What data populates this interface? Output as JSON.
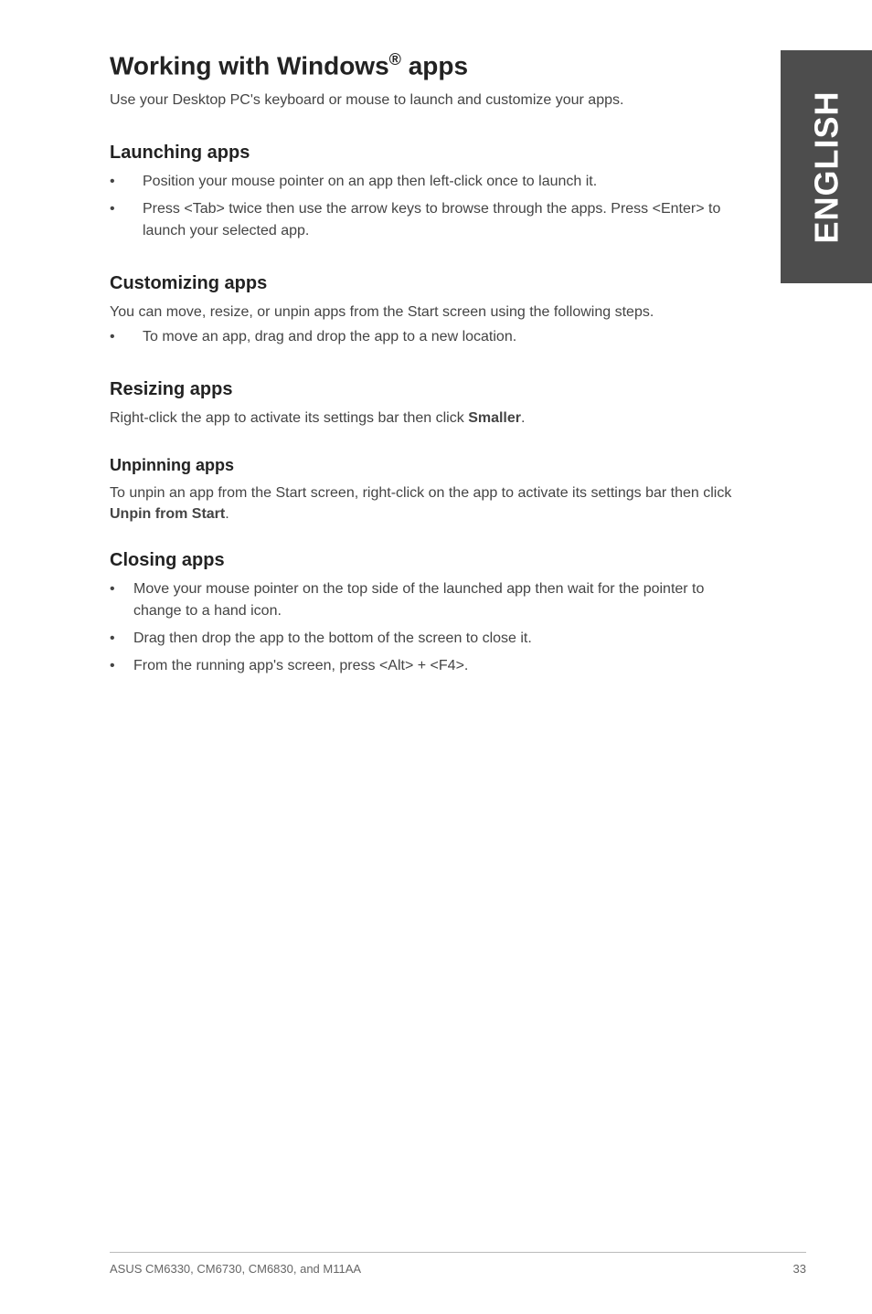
{
  "sidebar": {
    "label": "ENGLISH"
  },
  "heading": {
    "pre": "Working with Windows",
    "sup": "®",
    "post": " apps"
  },
  "intro": "Use your Desktop PC's keyboard or mouse to launch and customize your apps.",
  "sections": {
    "launching": {
      "title": "Launching apps",
      "items": [
        "Position your mouse pointer on an app then left-click once to launch it.",
        "Press <Tab> twice then use the arrow keys to browse through the apps. Press <Enter> to launch your selected app."
      ]
    },
    "customizing": {
      "title": "Customizing apps",
      "intro": "You can move, resize, or unpin apps from the Start screen using the following steps.",
      "items": [
        "To move an app, drag and drop the app to a new location."
      ]
    },
    "resizing": {
      "title": "Resizing apps",
      "text_pre": "Right-click the app to activate its settings bar then click ",
      "text_bold": "Smaller",
      "text_post": "."
    },
    "unpinning": {
      "title": "Unpinning apps",
      "text_pre": "To unpin an app from the Start screen, right-click on the app to activate its settings bar then click ",
      "text_bold": "Unpin from Start",
      "text_post": "."
    },
    "closing": {
      "title": "Closing apps",
      "items": [
        "Move your mouse pointer on the top side of the launched app then wait for the pointer to change to a hand icon.",
        "Drag then drop the app to the bottom of the screen to close it.",
        "From the running app's screen, press <Alt> + <F4>."
      ]
    }
  },
  "footer": {
    "left": "ASUS CM6330, CM6730, CM6830, and M11AA",
    "right": "33"
  }
}
